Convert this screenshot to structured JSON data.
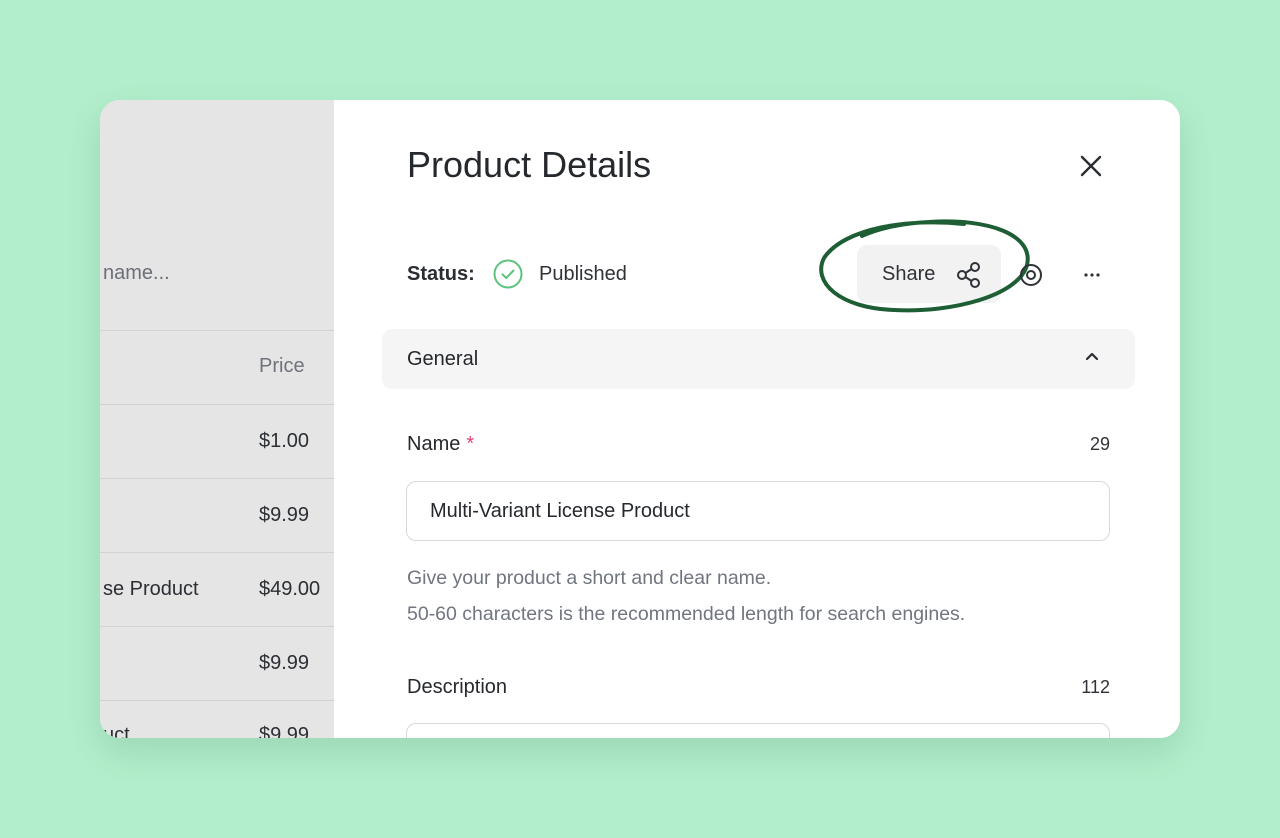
{
  "background_list": {
    "search_placeholder": "name...",
    "price_header": "Price",
    "rows": [
      {
        "name": "",
        "price": "$1.00"
      },
      {
        "name": "",
        "price": "$9.99"
      },
      {
        "name": "se Product",
        "price": "$49.00"
      },
      {
        "name": "",
        "price": "$9.99"
      },
      {
        "name": "uct",
        "price": "$9.99"
      }
    ]
  },
  "drawer": {
    "title": "Product Details",
    "status_label": "Status:",
    "status_value": "Published",
    "share_label": "Share",
    "section_title": "General",
    "name_field": {
      "label": "Name",
      "required_mark": "*",
      "char_count": "29",
      "value": "Multi-Variant License Product",
      "help_line_1": "Give your product a short and clear name.",
      "help_line_2": "50-60 characters is the recommended length for search engines."
    },
    "description_field": {
      "label": "Description",
      "char_count": "112"
    }
  },
  "icons": {
    "close": "close-icon",
    "status": "check-circle-icon",
    "share": "share-icon",
    "preview": "eye-icon",
    "more": "more-horizontal-icon",
    "collapse": "chevron-up-icon"
  },
  "colors": {
    "page_background": "#b2eecb",
    "published_green": "#5ec27e",
    "required_pink": "#e0457b",
    "highlight_ring": "#1e5e35"
  }
}
